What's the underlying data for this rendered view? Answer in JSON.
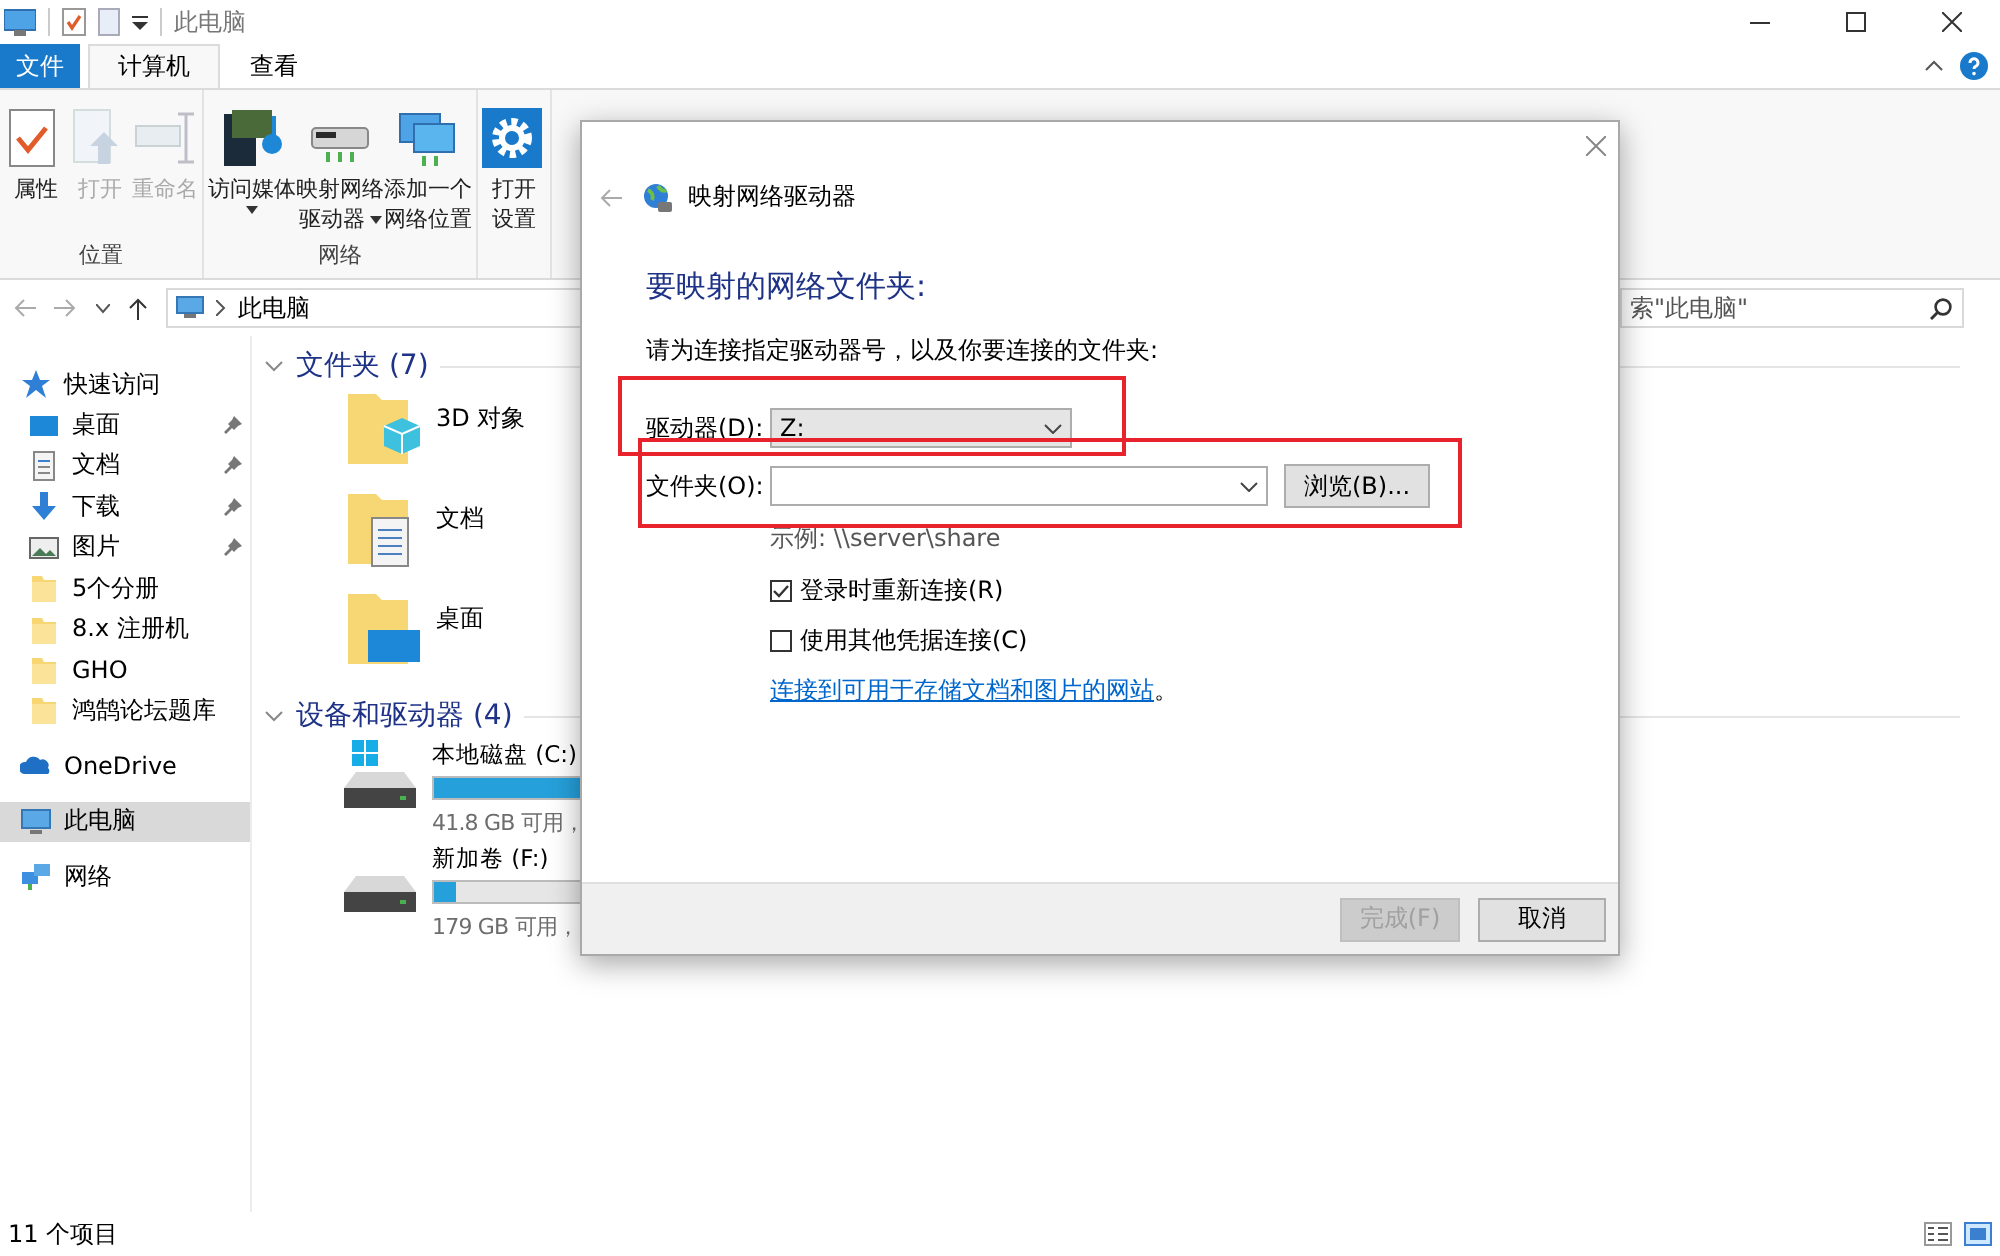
{
  "window": {
    "title": "此电脑"
  },
  "ribbon_tabs": [
    {
      "label": "文件",
      "kind": "file",
      "selected": false
    },
    {
      "label": "计算机",
      "kind": "tab",
      "selected": true
    },
    {
      "label": "查看",
      "kind": "tab",
      "selected": false
    }
  ],
  "ribbon_groups": [
    {
      "name": "位置",
      "buttons": [
        {
          "lines": [
            "属性"
          ],
          "kind": "properties",
          "disabled": false,
          "dropdown": false
        },
        {
          "lines": [
            "打开"
          ],
          "kind": "open",
          "disabled": true,
          "dropdown": false
        },
        {
          "lines": [
            "重命名"
          ],
          "kind": "rename",
          "disabled": true,
          "dropdown": false
        }
      ]
    },
    {
      "name": "网络",
      "buttons": [
        {
          "lines": [
            "访问媒体"
          ],
          "kind": "media",
          "disabled": false,
          "dropdown": true
        },
        {
          "lines": [
            "映射网络",
            "驱动器"
          ],
          "kind": "mapdrive",
          "disabled": false,
          "dropdown": true
        },
        {
          "lines": [
            "添加一个",
            "网络位置"
          ],
          "kind": "netloc",
          "disabled": false,
          "dropdown": false
        }
      ]
    },
    {
      "buttons": [
        {
          "lines": [
            "打开",
            "设置"
          ],
          "kind": "settings",
          "disabled": false,
          "dropdown": false
        }
      ]
    }
  ],
  "address": {
    "location": "此电脑",
    "search_placeholder": "索\"此电脑\""
  },
  "sidebar": {
    "items": [
      {
        "label": "快速访问",
        "kind": "quick",
        "pinned": false,
        "selected": false
      },
      {
        "label": "桌面",
        "kind": "desktop",
        "pinned": true,
        "selected": false
      },
      {
        "label": "文档",
        "kind": "documents",
        "pinned": true,
        "selected": false
      },
      {
        "label": "下载",
        "kind": "downloads",
        "pinned": true,
        "selected": false
      },
      {
        "label": "图片",
        "kind": "pictures",
        "pinned": true,
        "selected": false
      },
      {
        "label": "5个分册",
        "kind": "folder",
        "pinned": false,
        "selected": false
      },
      {
        "label": "8.x 注册机",
        "kind": "folder",
        "pinned": false,
        "selected": false
      },
      {
        "label": "GHO",
        "kind": "folder",
        "pinned": false,
        "selected": false
      },
      {
        "label": "鸿鹄论坛题库",
        "kind": "folder",
        "pinned": false,
        "selected": false
      },
      {
        "label": "OneDrive",
        "kind": "onedrive",
        "pinned": false,
        "selected": false
      },
      {
        "label": "此电脑",
        "kind": "pc",
        "pinned": false,
        "selected": true
      },
      {
        "label": "网络",
        "kind": "network",
        "pinned": false,
        "selected": false
      }
    ]
  },
  "sections": [
    {
      "title": "文件夹 (7)",
      "kind": "folders",
      "items": [
        {
          "label": "3D 对象",
          "kind": "objects3d"
        },
        {
          "label": "文档",
          "kind": "documents"
        },
        {
          "label": "桌面",
          "kind": "desktop"
        }
      ]
    },
    {
      "title": "设备和驱动器 (4)",
      "kind": "drives",
      "items": [
        {
          "label": "本地磁盘 (C:)",
          "kind": "system",
          "level": 0.75,
          "free": "41.8 GB 可用，"
        },
        {
          "label": "新加卷 (F:)",
          "kind": "disk",
          "level": 0.06,
          "free": "179 GB 可用，"
        }
      ]
    }
  ],
  "status_bar": {
    "count": "11 个项目"
  },
  "dialog": {
    "title": "映射网络驱动器",
    "heading": "要映射的网络文件夹:",
    "instruction": "请为连接指定驱动器号，以及你要连接的文件夹:",
    "fields": [
      {
        "label": "驱动器(D):",
        "value": "Z:",
        "kind": "drive",
        "highlight": true
      },
      {
        "label": "文件夹(O):",
        "kind": "folder",
        "highlight": true
      }
    ],
    "browse": "浏览(B)...",
    "example": "示例: \\\\server\\share",
    "options": [
      {
        "label": "登录时重新连接(R)",
        "checked": true
      },
      {
        "label": "使用其他凭据连接(C)",
        "checked": false
      }
    ],
    "link": "连接到可用于存储文档和图片的网站",
    "link_suffix": "。",
    "buttons": [
      {
        "label": "完成(F)",
        "disabled": true
      },
      {
        "label": "取消",
        "disabled": false
      }
    ]
  }
}
